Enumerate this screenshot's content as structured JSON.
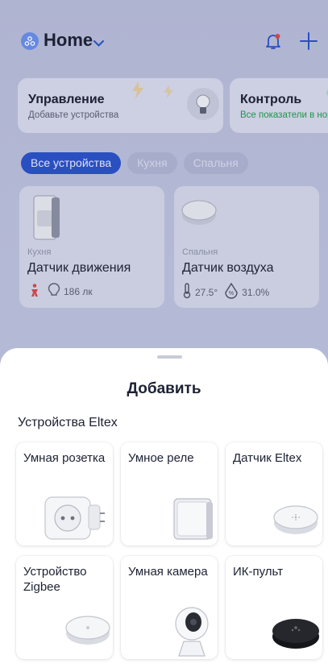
{
  "header": {
    "title": "Home",
    "icons": [
      "home-logo-icon",
      "chevron-down-icon",
      "bell-icon",
      "plus-icon"
    ]
  },
  "scenes": [
    {
      "title": "Управление",
      "subtitle": "Добавьте устройства"
    },
    {
      "title": "Контроль",
      "subtitle": "Все показатели в норме"
    }
  ],
  "filters": [
    "Все устройства",
    "Кухня",
    "Спальня"
  ],
  "devices": [
    {
      "room": "Кухня",
      "name": "Датчик движения",
      "stat1": "",
      "stat2": "186 лк"
    },
    {
      "room": "Спальня",
      "name": "Датчик воздуха",
      "stat1": "27.5°",
      "stat2": "31.0%"
    }
  ],
  "sheet": {
    "title": "Добавить",
    "section_title": "Устройства Eltex",
    "tiles": [
      {
        "label": "Умная розетка"
      },
      {
        "label": "Умное реле"
      },
      {
        "label": "Датчик Eltex"
      },
      {
        "label": "Устройство Zigbee"
      },
      {
        "label": "Умная камера"
      },
      {
        "label": "ИК-пульт"
      }
    ]
  },
  "colors": {
    "accent": "#2b52c8",
    "ok_green": "#1f9b4a",
    "alert_red": "#d94848",
    "dim_background": "#bcc1dd"
  }
}
